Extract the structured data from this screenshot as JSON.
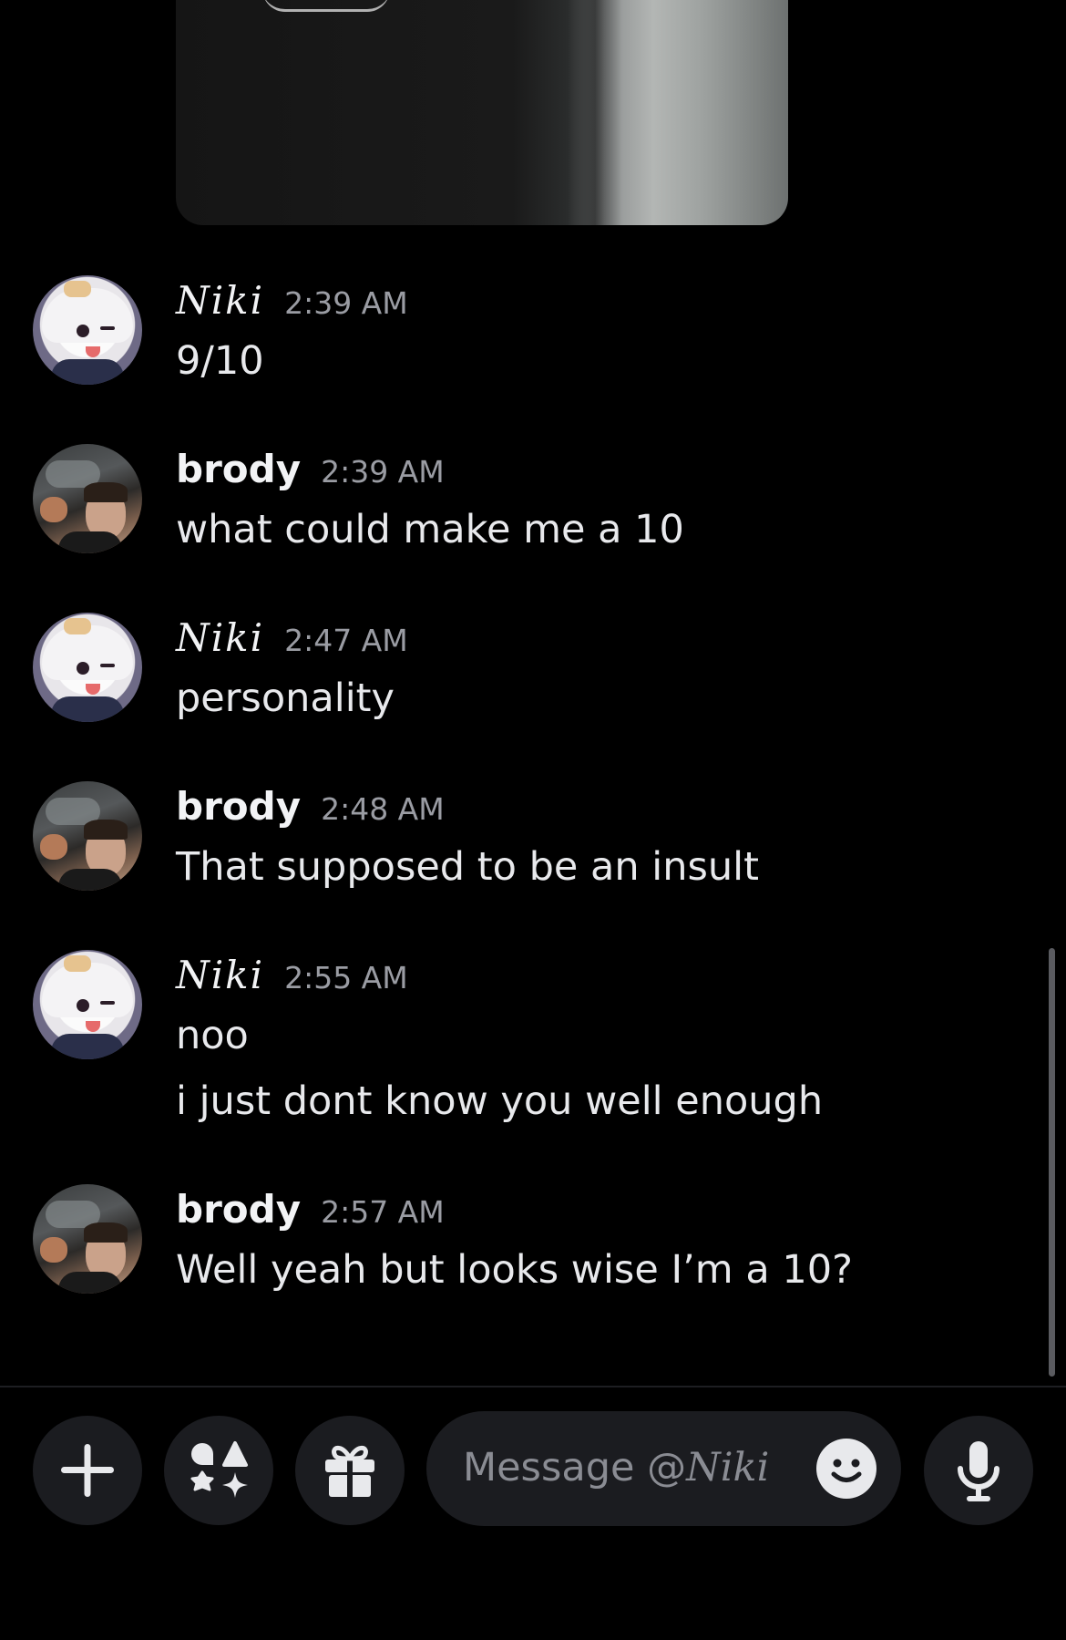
{
  "conversation": {
    "recipient": "Niki",
    "messages": [
      {
        "author": "Niki",
        "time": "2:39 AM",
        "lines": [
          "9/10"
        ]
      },
      {
        "author": "brody",
        "time": "2:39 AM",
        "lines": [
          "what could make me a 10"
        ]
      },
      {
        "author": "Niki",
        "time": "2:47 AM",
        "lines": [
          "personality"
        ]
      },
      {
        "author": "brody",
        "time": "2:48 AM",
        "lines": [
          "That supposed to be an insult"
        ]
      },
      {
        "author": "Niki",
        "time": "2:55 AM",
        "lines": [
          "noo",
          "i just dont know you well enough"
        ]
      },
      {
        "author": "brody",
        "time": "2:57 AM",
        "lines": [
          "Well yeah but looks wise I’m a 10?"
        ]
      }
    ]
  },
  "composer": {
    "placeholder_prefix": "Message @",
    "placeholder_name": "Niki",
    "buttons": [
      "plus-icon",
      "apps-icon",
      "gift-icon",
      "emoji-icon",
      "microphone-icon"
    ]
  },
  "colors": {
    "background": "#000000",
    "surface": "#1b1c20",
    "text": "#e8e9ec",
    "muted": "#9a9ca3"
  }
}
